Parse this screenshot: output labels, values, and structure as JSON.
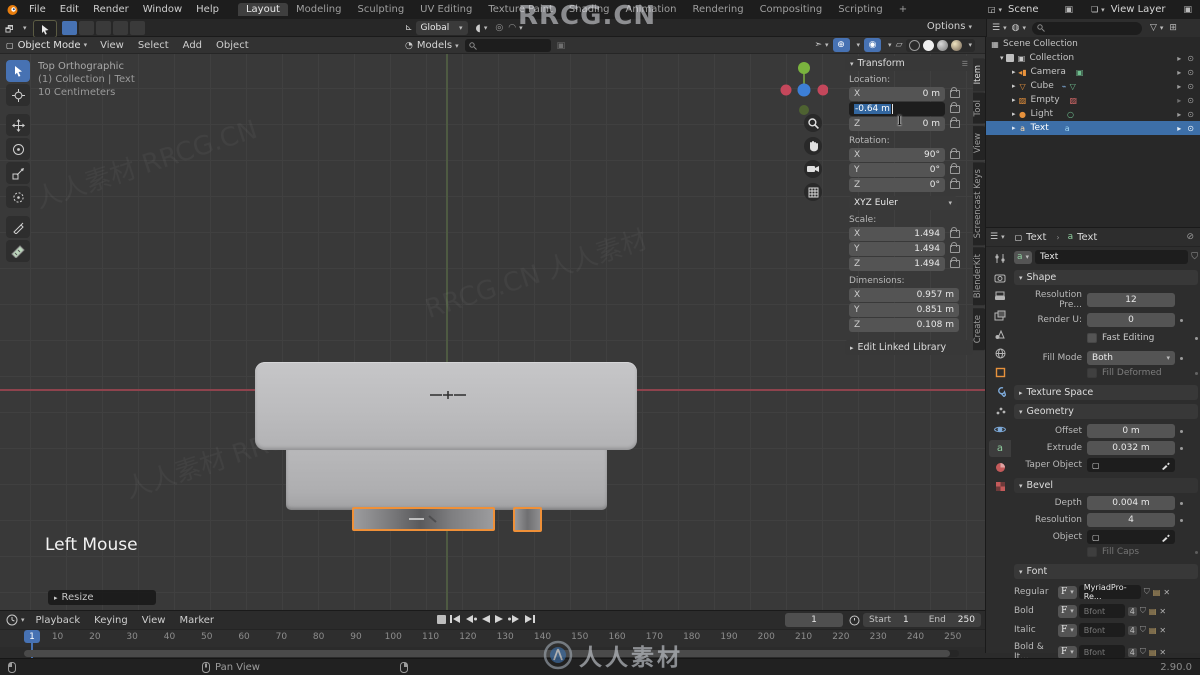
{
  "watermark": {
    "top": "RRCG.CN",
    "brand": "人人素材",
    "diag_a": "人人素材  RRCG.CN",
    "diag_b": "RRCG.CN  人人素材"
  },
  "topbar": {
    "menus": [
      "File",
      "Edit",
      "Render",
      "Window",
      "Help"
    ],
    "workspaces": [
      {
        "label": "Layout",
        "active": true
      },
      {
        "label": "Modeling"
      },
      {
        "label": "Sculpting"
      },
      {
        "label": "UV Editing"
      },
      {
        "label": "Texture Paint"
      },
      {
        "label": "Shading"
      },
      {
        "label": "Animation"
      },
      {
        "label": "Rendering"
      },
      {
        "label": "Compositing"
      },
      {
        "label": "Scripting"
      },
      {
        "label": "+"
      }
    ],
    "scene_label": "Scene",
    "view_layer_label": "View Layer"
  },
  "tool_settings": {
    "orientation": "Global",
    "options_label": "Options"
  },
  "viewport_header": {
    "mode_label": "Object Mode",
    "menus": [
      "View",
      "Select",
      "Add",
      "Object"
    ],
    "asset_dropdown": "Models"
  },
  "outliner": {
    "root": "Scene Collection",
    "items": [
      "Collection",
      "Camera",
      "Cube",
      "Empty",
      "Light",
      "Text"
    ]
  },
  "viewport": {
    "view_label": "Top Orthographic",
    "context_label": "(1) Collection | Text",
    "scale_label": "10 Centimeters",
    "screencast": "Left Mouse",
    "operator_label": "Resize"
  },
  "npanel": {
    "tabs": [
      {
        "label": "Item",
        "active": true
      },
      {
        "label": "Tool"
      },
      {
        "label": "View"
      },
      {
        "label": "Screencast Keys"
      },
      {
        "label": "BlenderKit"
      },
      {
        "label": "Create"
      }
    ],
    "transform_title": "Transform",
    "location_label": "Location:",
    "loc": {
      "x": "0 m",
      "y_edit": "-0.64 m",
      "z": "0 m"
    },
    "rotation_label": "Rotation:",
    "rot": {
      "x": "90°",
      "y": "0°",
      "z": "0°"
    },
    "euler": "XYZ Euler",
    "scale_label": "Scale:",
    "scl": {
      "x": "1.494",
      "y": "1.494",
      "z": "1.494"
    },
    "dimensions_label": "Dimensions:",
    "dim": {
      "x": "0.957 m",
      "y": "0.851 m",
      "z": "0.108 m"
    },
    "axis_x": "X",
    "axis_y": "Y",
    "axis_z": "Z",
    "linked_label": "Edit Linked Library"
  },
  "properties": {
    "breadcrumb_obj": "Text",
    "breadcrumb_data": "Text",
    "name_value": "Text",
    "shape": {
      "title": "Shape",
      "resolution_label": "Resolution Pre...",
      "resolution": "12",
      "render_label": "Render U:",
      "render": "0",
      "fast_editing": "Fast Editing",
      "fill_mode_label": "Fill Mode",
      "fill_mode": "Both",
      "fill_deformed": "Fill Deformed"
    },
    "texture_space_title": "Texture Space",
    "geometry": {
      "title": "Geometry",
      "offset_label": "Offset",
      "offset": "0 m",
      "extrude_label": "Extrude",
      "extrude": "0.032 m",
      "taper_label": "Taper Object",
      "bevel_title": "Bevel",
      "depth_label": "Depth",
      "depth": "0.004 m",
      "resolution_label": "Resolution",
      "resolution": "4",
      "object_label": "Object",
      "fill_caps": "Fill Caps"
    },
    "font": {
      "title": "Font",
      "f": "F",
      "regular_label": "Regular",
      "regular": "MyriadPro-Re...",
      "bold_label": "Bold",
      "italic_label": "Italic",
      "bold_italic_label": "Bold & It...",
      "placeholder": "Bfont",
      "users": "4"
    }
  },
  "timeline": {
    "menus": [
      "Playback",
      "Keying",
      "View",
      "Marker"
    ],
    "frame": "1",
    "start_label": "Start",
    "start": "1",
    "end_label": "End",
    "end": "250",
    "ticks": [
      10,
      20,
      30,
      40,
      50,
      60,
      70,
      80,
      90,
      100,
      110,
      120,
      130,
      140,
      150,
      160,
      170,
      180,
      190,
      200,
      210,
      220,
      230,
      240,
      250
    ]
  },
  "statusbar": {
    "pan_label": "Pan View",
    "version": "2.90.0"
  }
}
